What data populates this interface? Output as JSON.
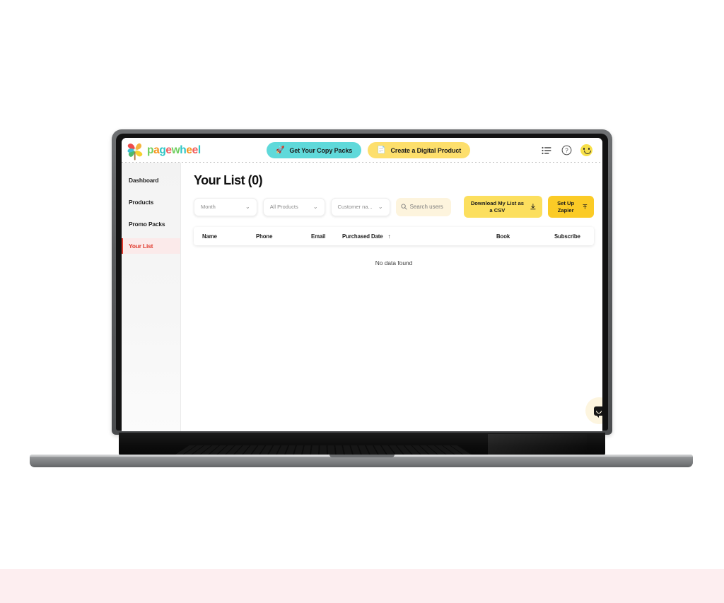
{
  "brand": {
    "logo_icon": "pinwheel-icon",
    "wordmark_letters": [
      {
        "ch": "p",
        "color": "#6fcf5f"
      },
      {
        "ch": "a",
        "color": "#f7941e"
      },
      {
        "ch": "g",
        "color": "#2ec6c6"
      },
      {
        "ch": "e",
        "color": "#f25c5c"
      },
      {
        "ch": "w",
        "color": "#6fcf5f"
      },
      {
        "ch": "h",
        "color": "#2ec6c6"
      },
      {
        "ch": "e",
        "color": "#f7941e"
      },
      {
        "ch": "e",
        "color": "#f25c5c"
      },
      {
        "ch": "l",
        "color": "#2ec6c6"
      }
    ],
    "wordmark_text": "pagewheel"
  },
  "header": {
    "cta_copy_packs": "Get Your Copy Packs",
    "cta_copy_packs_icon": "rocket-icon",
    "cta_copy_packs_color": "#5fd9da",
    "cta_digital_product": "Create a Digital Product",
    "cta_digital_product_icon": "document-icon",
    "cta_digital_product_color": "#fddf6c",
    "icons": {
      "list": "list-icon",
      "help": "question-circle-icon",
      "profile": "smiley-avatar-icon"
    }
  },
  "sidebar": {
    "items": [
      {
        "label": "Dashboard",
        "active": false
      },
      {
        "label": "Products",
        "active": false
      },
      {
        "label": "Promo Packs",
        "active": false
      },
      {
        "label": "Your List",
        "active": true
      }
    ],
    "active_color": "#e0392c",
    "active_bg": "#fbeaea"
  },
  "main": {
    "page_title": "Your List (0)",
    "toolbar": {
      "month_filter": "Month",
      "products_filter": "All Products",
      "customer_filter": "Customer na...",
      "search_placeholder": "Search users",
      "search_value": "",
      "search_icon": "search-icon",
      "download_csv": "Download My List as a CSV",
      "download_csv_icon": "download-icon",
      "setup_zapier": "Set Up Zapier",
      "setup_zapier_icon": "upload-icon"
    },
    "table": {
      "columns": [
        "Name",
        "Phone",
        "Email",
        "Purchased Date",
        "Book",
        "Subscribe"
      ],
      "sort_column": "Purchased Date",
      "sort_direction": "ascending",
      "sort_arrow": "↑",
      "rows": [],
      "empty_message": "No data found"
    }
  },
  "chat_widget": {
    "icon": "chat-bubble-icon"
  },
  "page": {
    "background": "#ffffff",
    "bottom_strip_color": "#fdeef0"
  }
}
